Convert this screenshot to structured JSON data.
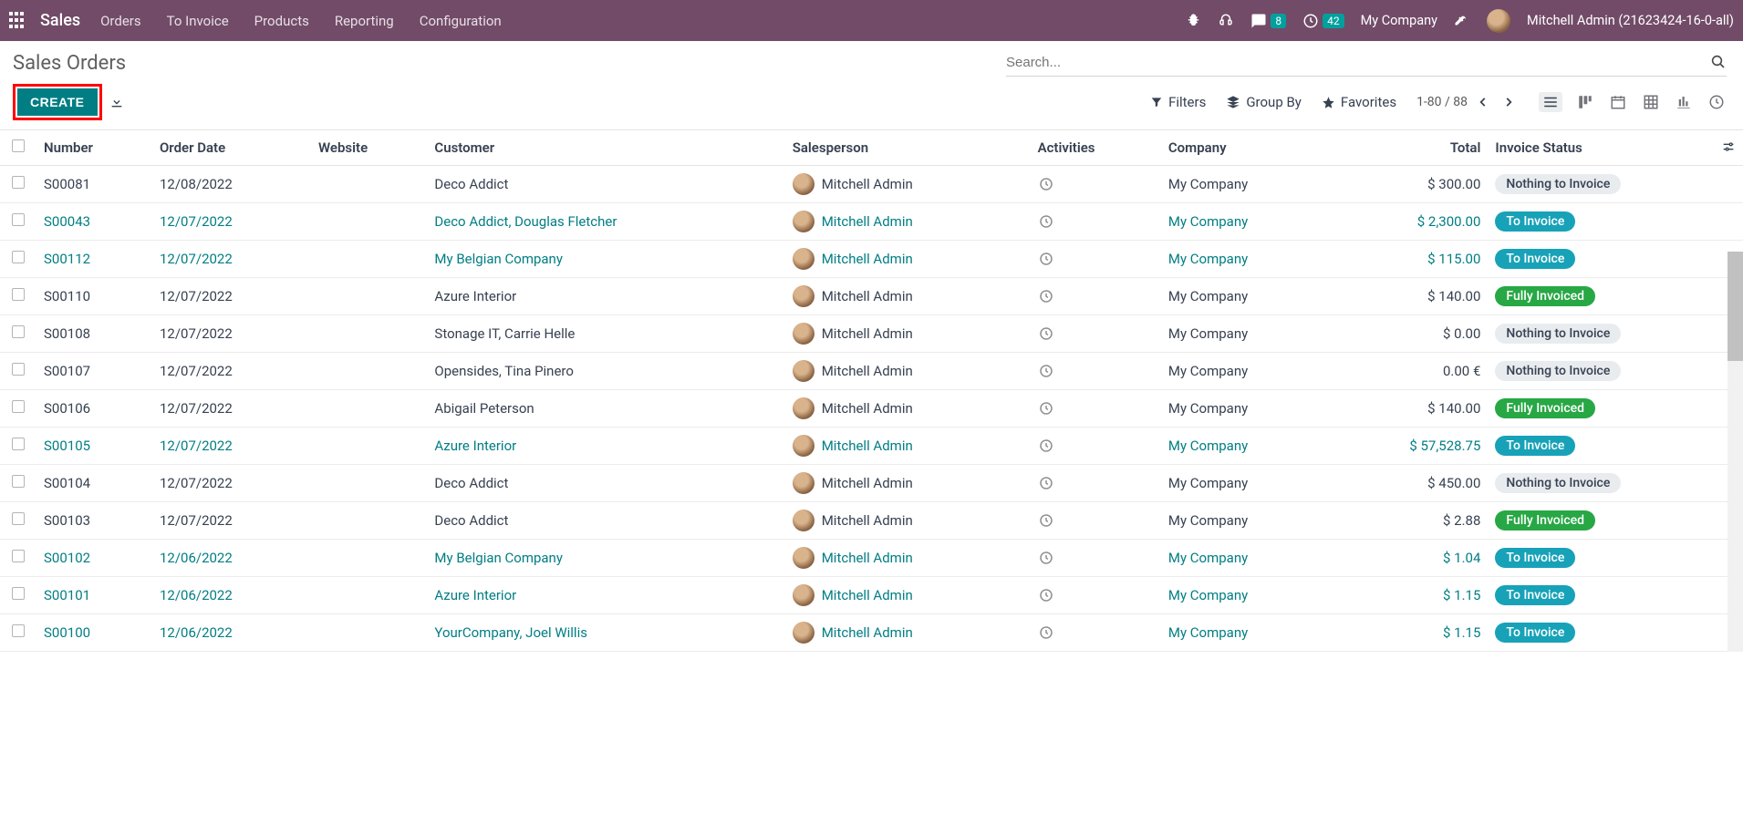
{
  "topbar": {
    "brand": "Sales",
    "menu": [
      "Orders",
      "To Invoice",
      "Products",
      "Reporting",
      "Configuration"
    ],
    "messages_badge": "8",
    "activities_badge": "42",
    "company": "My Company",
    "user": "Mitchell Admin (21623424-16-0-all)"
  },
  "header": {
    "title": "Sales Orders",
    "search_placeholder": "Search..."
  },
  "toolbar": {
    "create_label": "CREATE",
    "filters": "Filters",
    "groupby": "Group By",
    "favorites": "Favorites",
    "pager": "1-80 / 88"
  },
  "columns": {
    "number": "Number",
    "orderdate": "Order Date",
    "website": "Website",
    "customer": "Customer",
    "salesperson": "Salesperson",
    "activities": "Activities",
    "company": "Company",
    "total": "Total",
    "invoice_status": "Invoice Status"
  },
  "rows": [
    {
      "number": "S00081",
      "date": "12/08/2022",
      "customer": "Deco Addict",
      "sales": "Mitchell Admin",
      "company": "My Company",
      "total": "$ 300.00",
      "status": "Nothing to Invoice",
      "style": "nothing",
      "highlight": false
    },
    {
      "number": "S00043",
      "date": "12/07/2022",
      "customer": "Deco Addict, Douglas Fletcher",
      "sales": "Mitchell Admin",
      "company": "My Company",
      "total": "$ 2,300.00",
      "status": "To Invoice",
      "style": "toinvoice",
      "highlight": true
    },
    {
      "number": "S00112",
      "date": "12/07/2022",
      "customer": "My Belgian Company",
      "sales": "Mitchell Admin",
      "company": "My Company",
      "total": "$ 115.00",
      "status": "To Invoice",
      "style": "toinvoice",
      "highlight": true
    },
    {
      "number": "S00110",
      "date": "12/07/2022",
      "customer": "Azure Interior",
      "sales": "Mitchell Admin",
      "company": "My Company",
      "total": "$ 140.00",
      "status": "Fully Invoiced",
      "style": "fully",
      "highlight": false
    },
    {
      "number": "S00108",
      "date": "12/07/2022",
      "customer": "Stonage IT, Carrie Helle",
      "sales": "Mitchell Admin",
      "company": "My Company",
      "total": "$ 0.00",
      "status": "Nothing to Invoice",
      "style": "nothing",
      "highlight": false
    },
    {
      "number": "S00107",
      "date": "12/07/2022",
      "customer": "Opensides, Tina Pinero",
      "sales": "Mitchell Admin",
      "company": "My Company",
      "total": "0.00 €",
      "status": "Nothing to Invoice",
      "style": "nothing",
      "highlight": false
    },
    {
      "number": "S00106",
      "date": "12/07/2022",
      "customer": "Abigail Peterson",
      "sales": "Mitchell Admin",
      "company": "My Company",
      "total": "$ 140.00",
      "status": "Fully Invoiced",
      "style": "fully",
      "highlight": false
    },
    {
      "number": "S00105",
      "date": "12/07/2022",
      "customer": "Azure Interior",
      "sales": "Mitchell Admin",
      "company": "My Company",
      "total": "$ 57,528.75",
      "status": "To Invoice",
      "style": "toinvoice",
      "highlight": true
    },
    {
      "number": "S00104",
      "date": "12/07/2022",
      "customer": "Deco Addict",
      "sales": "Mitchell Admin",
      "company": "My Company",
      "total": "$ 450.00",
      "status": "Nothing to Invoice",
      "style": "nothing",
      "highlight": false
    },
    {
      "number": "S00103",
      "date": "12/07/2022",
      "customer": "Deco Addict",
      "sales": "Mitchell Admin",
      "company": "My Company",
      "total": "$ 2.88",
      "status": "Fully Invoiced",
      "style": "fully",
      "highlight": false
    },
    {
      "number": "S00102",
      "date": "12/06/2022",
      "customer": "My Belgian Company",
      "sales": "Mitchell Admin",
      "company": "My Company",
      "total": "$ 1.04",
      "status": "To Invoice",
      "style": "toinvoice",
      "highlight": true
    },
    {
      "number": "S00101",
      "date": "12/06/2022",
      "customer": "Azure Interior",
      "sales": "Mitchell Admin",
      "company": "My Company",
      "total": "$ 1.15",
      "status": "To Invoice",
      "style": "toinvoice",
      "highlight": true
    },
    {
      "number": "S00100",
      "date": "12/06/2022",
      "customer": "YourCompany, Joel Willis",
      "sales": "Mitchell Admin",
      "company": "My Company",
      "total": "$ 1.15",
      "status": "To Invoice",
      "style": "toinvoice",
      "highlight": true
    }
  ]
}
